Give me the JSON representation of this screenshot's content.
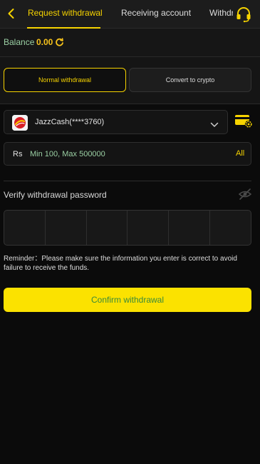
{
  "header": {
    "tabs": [
      "Request withdrawal",
      "Receiving account",
      "Withdrawal history"
    ],
    "active_tab": 0,
    "icons": {
      "back": "chevron-left-icon",
      "support": "headset-icon"
    }
  },
  "balance": {
    "label": "Balance",
    "value": "0.00",
    "icon": "refresh-icon"
  },
  "methods": [
    {
      "label": "Normal withdrawal",
      "selected": true
    },
    {
      "label": "Convert to crypto",
      "selected": false
    }
  ],
  "account": {
    "name": "JazzCash(****3760)",
    "logo_text": "Jazz"
  },
  "amount": {
    "currency": "Rs",
    "placeholder": "Min 100, Max 500000",
    "all_label": "All"
  },
  "password": {
    "label": "Verify withdrawal password",
    "digits": 6,
    "icon": "eye-off-icon"
  },
  "reminder": "Reminder：Please make sure the information you enter is correct to avoid failure to receive the funds.",
  "confirm_label": "Confirm withdrawal",
  "colors": {
    "accent": "#f6d300",
    "background": "#0b0b0b",
    "success_text": "#9bd0a4",
    "balance": "#f6c21b"
  }
}
